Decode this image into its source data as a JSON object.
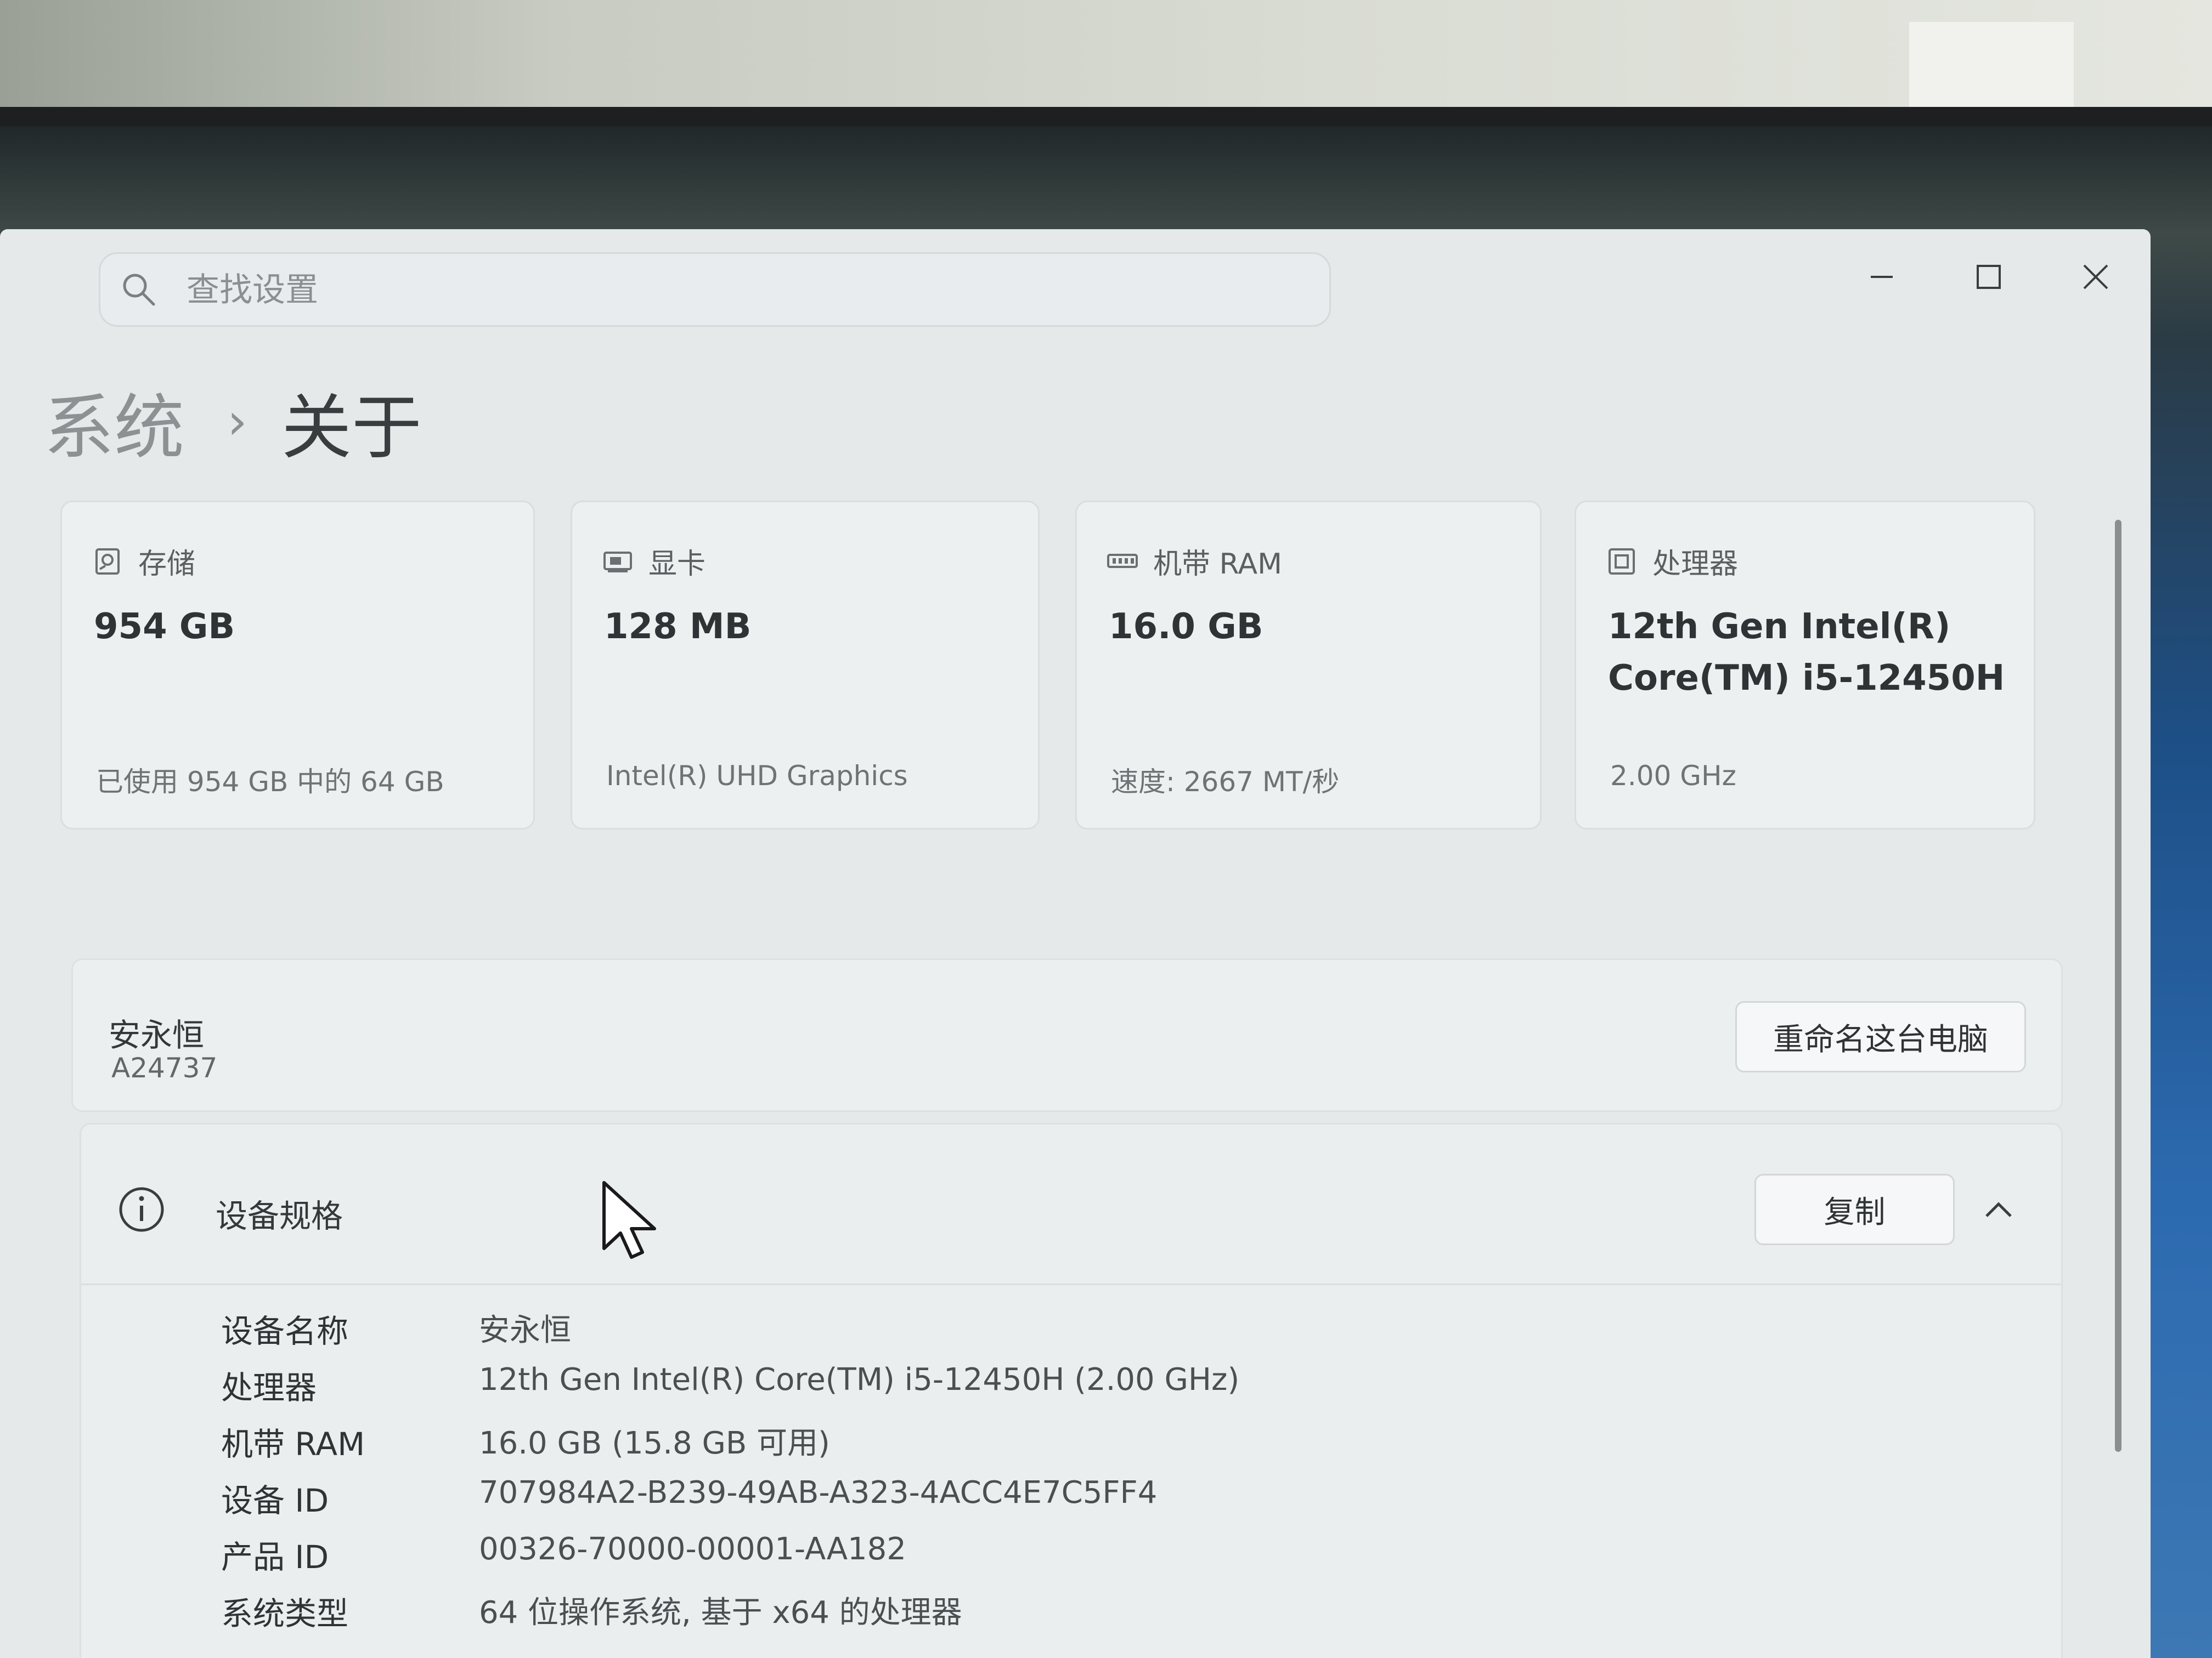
{
  "search": {
    "placeholder": "查找设置"
  },
  "breadcrumb": {
    "parent": "系统",
    "separator": "›",
    "current": "关于"
  },
  "cards": [
    {
      "icon": "storage-icon",
      "label": "存储",
      "value": "954 GB",
      "sub": "已使用 954 GB 中的 64 GB"
    },
    {
      "icon": "gpu-icon",
      "label": "显卡",
      "value": "128 MB",
      "sub": "Intel(R) UHD Graphics"
    },
    {
      "icon": "ram-icon",
      "label": "机带 RAM",
      "value": "16.0 GB",
      "sub": "速度: 2667 MT/秒"
    },
    {
      "icon": "processor-icon",
      "label": "处理器",
      "value": "12th Gen Intel(R) Core(TM) i5-12450H",
      "sub": "2.00 GHz"
    }
  ],
  "pc": {
    "name": "安永恒",
    "model": "A24737",
    "rename_label": "重命名这台电脑"
  },
  "specs": {
    "title": "设备规格",
    "copy_label": "复制",
    "rows": [
      {
        "label": "设备名称",
        "value": "安永恒"
      },
      {
        "label": "处理器",
        "value": "12th Gen Intel(R) Core(TM) i5-12450H (2.00 GHz)"
      },
      {
        "label": "机带 RAM",
        "value": "16.0 GB (15.8 GB 可用)"
      },
      {
        "label": "设备 ID",
        "value": "707984A2-B239-49AB-A323-4ACC4E7C5FF4"
      },
      {
        "label": "产品 ID",
        "value": "00326-70000-00001-AA182"
      },
      {
        "label": "系统类型",
        "value": "64 位操作系统, 基于 x64 的处理器"
      }
    ]
  }
}
